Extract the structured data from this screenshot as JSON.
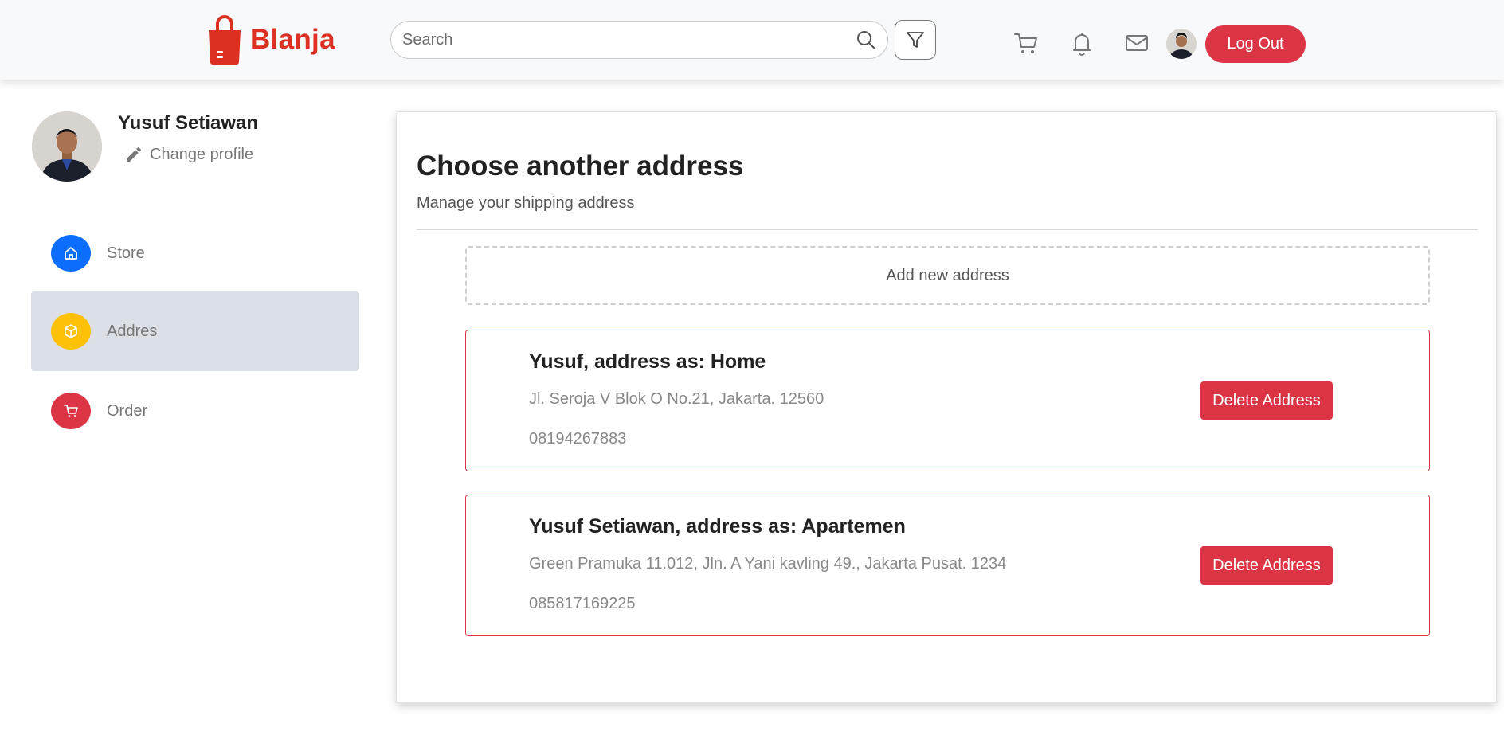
{
  "brand": {
    "name": "Blanja",
    "color": "#db3022"
  },
  "header": {
    "search_placeholder": "Search",
    "icons": [
      "search-icon",
      "filter-icon",
      "cart-icon",
      "bell-icon",
      "mail-icon"
    ],
    "logout_label": "Log Out",
    "accent": "#db3545"
  },
  "profile": {
    "name": "Yusuf Setiawan",
    "change_label": "Change profile"
  },
  "sidebar": {
    "items": [
      {
        "label": "Store",
        "icon": "home-icon",
        "color": "#0d6efd",
        "active": false
      },
      {
        "label": "Addres",
        "icon": "box-icon",
        "color": "#ffc107",
        "active": true
      },
      {
        "label": "Order",
        "icon": "cart-icon",
        "color": "#dc3545",
        "active": false
      }
    ]
  },
  "main": {
    "title": "Choose another address",
    "subtitle": "Manage your shipping address",
    "add_label": "Add new address",
    "addresses": [
      {
        "title": "Yusuf, address as: Home",
        "street": "Jl. Seroja V Blok O No.21, Jakarta. 12560",
        "phone": "08194267883",
        "delete_label": "Delete Address"
      },
      {
        "title": "Yusuf Setiawan, address as: Apartemen",
        "street": "Green Pramuka 11.012, Jln. A Yani kavling 49., Jakarta Pusat. 1234",
        "phone": "085817169225",
        "delete_label": "Delete Address"
      }
    ]
  }
}
